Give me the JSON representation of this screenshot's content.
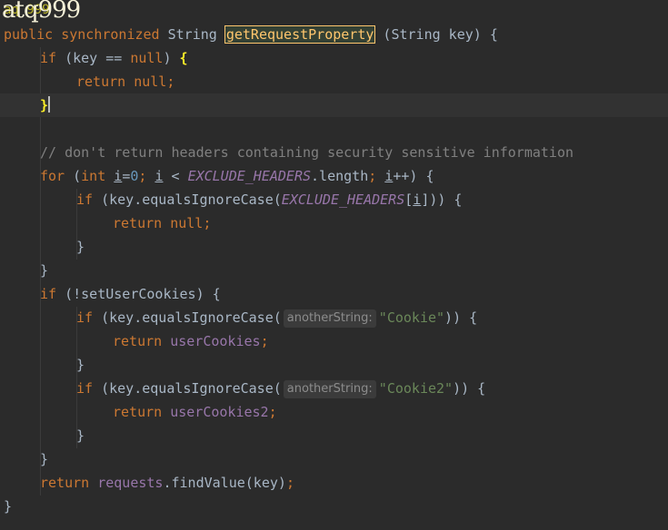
{
  "watermark": "atq999",
  "annotation_fragment": "aq  999",
  "code": {
    "line1": {
      "k1": "public",
      "k2": "synchronized",
      "type": "String",
      "method": "getRequestProperty",
      "params": " (String key) {"
    },
    "line2": {
      "kw": "if",
      "mid": " (key == ",
      "nul": "null",
      ") ": ") ",
      "brace": "{"
    },
    "line3": {
      "kw": "return",
      "sp": " ",
      "nul": "null",
      "semi": ";"
    },
    "line4": {
      "brace": "}"
    },
    "line6": {
      "comment": "// don't return headers containing security sensitive information"
    },
    "line7": {
      "kw": "for",
      "p1": " (",
      "int": "int",
      " sp": " ",
      "i1": "i",
      "eq": "=",
      "zero": "0",
      "semi1": "; ",
      "i2": "i",
      "lt": " < ",
      "const": "EXCLUDE_HEADERS",
      ".len": ".length",
      "semi2": "; ",
      "i3": "i",
      "rest": "++) {"
    },
    "line8": {
      "kw": "if",
      "p1": " (key.equalsIgnoreCase(",
      "const": "EXCLUDE_HEADERS",
      "br": "[",
      "i": "i",
      "end": "])) {"
    },
    "line9": {
      "kw": "return",
      "sp": " ",
      "nul": "null",
      "semi": ";"
    },
    "line10": {
      "brace": "}"
    },
    "line11": {
      "brace": "}"
    },
    "line12": {
      "kw": "if",
      "rest": " (!setUserCookies) {"
    },
    "line13": {
      "kw": "if",
      "p1": " (key.equalsIgnoreCase(",
      "hint": "anotherString:",
      "str": "\"Cookie\"",
      "end": ")) {"
    },
    "line14": {
      "kw": "return",
      "sp": " ",
      "field": "userCookies",
      "semi": ";"
    },
    "line15": {
      "brace": "}"
    },
    "line16": {
      "kw": "if",
      "p1": " (key.equalsIgnoreCase(",
      "hint": "anotherString:",
      "str": "\"Cookie2\"",
      "end": ")) {"
    },
    "line17": {
      "kw": "return",
      "sp": " ",
      "field": "userCookies2",
      "semi": ";"
    },
    "line18": {
      "brace": "}"
    },
    "line19": {
      "brace": "}"
    },
    "line20": {
      "kw": "return",
      "sp": " ",
      "field": "requests",
      ".fv": ".findValue(key)",
      "semi": ";"
    },
    "line21": {
      "brace": "}"
    }
  },
  "colors": {
    "background": "#2b2b2b",
    "keyword": "#cc7832",
    "comment": "#808080",
    "number": "#6897bb",
    "string": "#6a8759",
    "constant": "#9876aa",
    "method": "#ffc66d"
  }
}
